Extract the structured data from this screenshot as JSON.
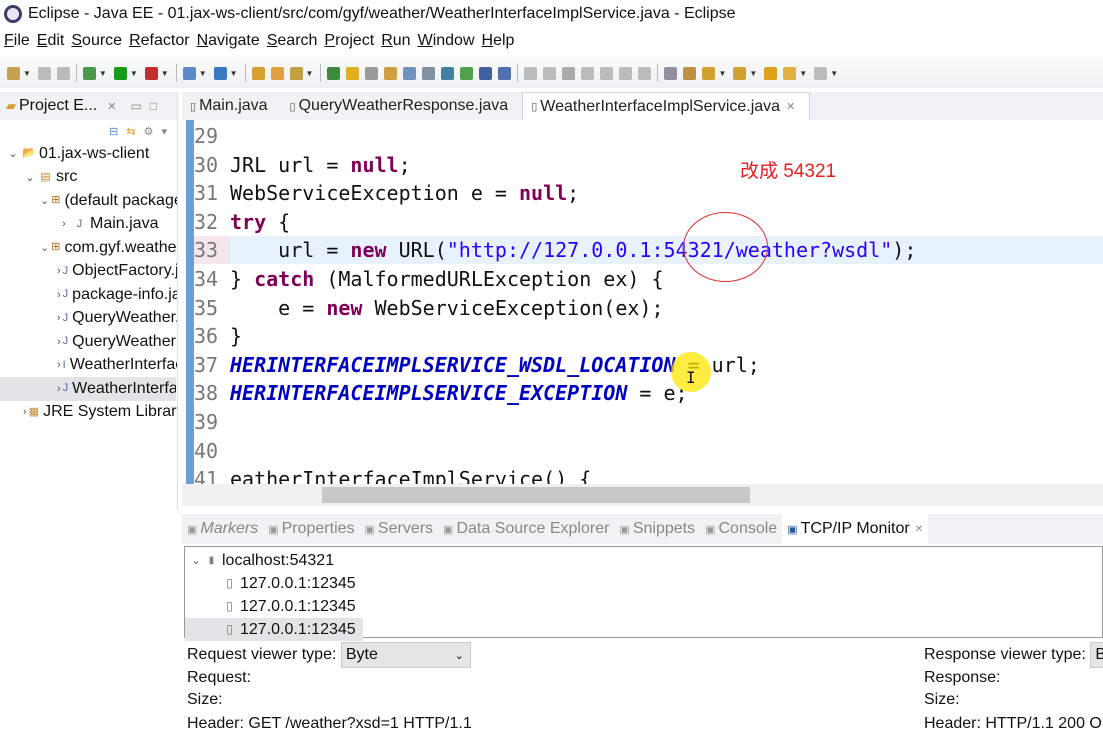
{
  "window": {
    "title": "Eclipse - Java EE - 01.jax-ws-client/src/com/gyf/weather/WeatherInterfaceImplService.java - Eclipse"
  },
  "menu": [
    "File",
    "Edit",
    "Source",
    "Refactor",
    "Navigate",
    "Search",
    "Project",
    "Run",
    "Window",
    "Help"
  ],
  "toolbar": [
    {
      "icon": "new-icon",
      "color": "#c8a050",
      "dd": true
    },
    {
      "icon": "save-icon",
      "color": "#bbb"
    },
    {
      "icon": "save-all-icon",
      "color": "#bbb",
      "sep": true
    },
    {
      "icon": "debug-icon",
      "color": "#4a9a4a",
      "dd": true
    },
    {
      "icon": "run-icon",
      "color": "#1a9a1a",
      "dd": true
    },
    {
      "icon": "external-tools-icon",
      "color": "#c03030",
      "dd": true,
      "sep": true
    },
    {
      "icon": "new-server-icon",
      "color": "#5a8ac8",
      "dd": true
    },
    {
      "icon": "web-service-icon",
      "color": "#3a7ac0",
      "dd": true,
      "sep": true
    },
    {
      "icon": "open-type-icon",
      "color": "#d8a030"
    },
    {
      "icon": "open-folder-icon",
      "color": "#e0a040"
    },
    {
      "icon": "search-icon",
      "color": "#c0a040",
      "dd": true,
      "sep": true
    },
    {
      "icon": "pin-icon",
      "color": "#3a8a3a"
    },
    {
      "icon": "highlight-icon",
      "color": "#e0b020"
    },
    {
      "icon": "link-icon",
      "color": "#999"
    },
    {
      "icon": "annotation-icon",
      "color": "#d0a040"
    },
    {
      "icon": "show-whitespace-icon",
      "color": "#7090c0"
    },
    {
      "icon": "block-icon",
      "color": "#8090a0"
    },
    {
      "icon": "globe-icon",
      "color": "#4080a0"
    },
    {
      "icon": "refresh-icon",
      "color": "#50a050"
    },
    {
      "icon": "monitor-icon",
      "color": "#4060a0"
    },
    {
      "icon": "skip-icon",
      "color": "#5070b0",
      "sep": true
    },
    {
      "icon": "resume-icon",
      "color": "#bbb"
    },
    {
      "icon": "suspend-icon",
      "color": "#bbb"
    },
    {
      "icon": "stop-icon",
      "color": "#aaa"
    },
    {
      "icon": "disconnect-icon",
      "color": "#bbb"
    },
    {
      "icon": "step-into-icon",
      "color": "#bbb"
    },
    {
      "icon": "step-over-icon",
      "color": "#bbb"
    },
    {
      "icon": "step-return-icon",
      "color": "#bbb",
      "sep": true
    },
    {
      "icon": "task-icon",
      "color": "#9090a0"
    },
    {
      "icon": "palette-icon",
      "color": "#c09040"
    },
    {
      "icon": "next-annotation-icon",
      "color": "#d0a030",
      "dd": true
    },
    {
      "icon": "prev-annotation-icon",
      "color": "#d0a030",
      "dd": true
    },
    {
      "icon": "back-icon",
      "color": "#e0a020"
    },
    {
      "icon": "back-arrow-icon",
      "color": "#e0b040",
      "dd": true
    },
    {
      "icon": "forward-icon",
      "color": "#bbb",
      "dd": true
    }
  ],
  "explorer": {
    "title": "Project E...",
    "items": [
      {
        "label": "01.jax-ws-client",
        "indent": 0,
        "arrow": "⌄",
        "icon": "project-icon",
        "glyph": "📂",
        "selected": false
      },
      {
        "label": "src",
        "indent": 1,
        "arrow": "⌄",
        "icon": "source-folder-icon",
        "glyph": "▤",
        "selected": false
      },
      {
        "label": "(default package)",
        "indent": 2,
        "arrow": "⌄",
        "icon": "package-icon",
        "glyph": "⊞",
        "selected": false
      },
      {
        "label": "Main.java",
        "indent": 3,
        "arrow": "›",
        "icon": "java-file-icon",
        "glyph": "J",
        "selected": false
      },
      {
        "label": "com.gyf.weather",
        "indent": 2,
        "arrow": "⌄",
        "icon": "package-icon",
        "glyph": "⊞",
        "selected": false
      },
      {
        "label": "ObjectFactory.java",
        "indent": 3,
        "arrow": "›",
        "icon": "java-file-icon",
        "glyph": "J",
        "selected": false
      },
      {
        "label": "package-info.java",
        "indent": 3,
        "arrow": "›",
        "icon": "java-file-icon",
        "glyph": "J",
        "selected": false
      },
      {
        "label": "QueryWeather.java",
        "indent": 3,
        "arrow": "›",
        "icon": "java-file-icon",
        "glyph": "J",
        "selected": false
      },
      {
        "label": "QueryWeatherResponse.java",
        "indent": 3,
        "arrow": "›",
        "icon": "java-file-icon",
        "glyph": "J",
        "selected": false
      },
      {
        "label": "WeatherInterface.java",
        "indent": 3,
        "arrow": "›",
        "icon": "java-interface-icon",
        "glyph": "I",
        "selected": false
      },
      {
        "label": "WeatherInterfaceImplService.java",
        "indent": 3,
        "arrow": "›",
        "icon": "java-file-icon",
        "glyph": "J",
        "selected": true
      },
      {
        "label": "JRE System Library",
        "indent": 1,
        "arrow": "›",
        "icon": "library-icon",
        "glyph": "▦",
        "selected": false
      }
    ]
  },
  "editor": {
    "tabs": [
      {
        "label": "Main.java",
        "active": false
      },
      {
        "label": "QueryWeatherResponse.java",
        "active": false
      },
      {
        "label": "WeatherInterfaceImplService.java",
        "active": true
      }
    ],
    "lines": [
      {
        "n": "29",
        "t": []
      },
      {
        "n": "30",
        "t": [
          [
            "p",
            "JRL url = "
          ],
          [
            "kw",
            "null"
          ],
          [
            "p",
            ";"
          ]
        ]
      },
      {
        "n": "31",
        "t": [
          [
            "p",
            "WebServiceException e = "
          ],
          [
            "kw",
            "null"
          ],
          [
            "p",
            ";"
          ]
        ]
      },
      {
        "n": "32",
        "t": [
          [
            "kw",
            "try"
          ],
          [
            "p",
            " {"
          ]
        ]
      },
      {
        "n": "33",
        "cur": true,
        "t": [
          [
            "p",
            "    url = "
          ],
          [
            "kw",
            "new"
          ],
          [
            "p",
            " URL("
          ],
          [
            "str",
            "\"http://127.0.0.1:54321/weather?wsdl\""
          ],
          [
            "p",
            ");"
          ]
        ]
      },
      {
        "n": "34",
        "t": [
          [
            "p",
            "} "
          ],
          [
            "kw",
            "catch"
          ],
          [
            "p",
            " (MalformedURLException ex) {"
          ]
        ]
      },
      {
        "n": "35",
        "t": [
          [
            "p",
            "    e = "
          ],
          [
            "kw",
            "new"
          ],
          [
            "p",
            " WebServiceException(ex);"
          ]
        ]
      },
      {
        "n": "36",
        "t": [
          [
            "p",
            "}"
          ]
        ]
      },
      {
        "n": "37",
        "t": [
          [
            "cst",
            "HERINTERFACEIMPLSERVICE_WSDL_LOCATION"
          ],
          [
            "p",
            " = url;"
          ]
        ]
      },
      {
        "n": "38",
        "t": [
          [
            "cst",
            "HERINTERFACEIMPLSERVICE_EXCEPTION"
          ],
          [
            "p",
            " = e;"
          ]
        ]
      },
      {
        "n": "39",
        "t": []
      },
      {
        "n": "40",
        "t": []
      },
      {
        "n": "41",
        "t": [
          [
            "p",
            "eatherInterfaceImplService() {"
          ]
        ]
      }
    ],
    "annotation": "改成 54321"
  },
  "bottom": {
    "tabs": [
      {
        "label": "Markers",
        "icon": "markers-icon"
      },
      {
        "label": "Properties",
        "icon": "properties-icon"
      },
      {
        "label": "Servers",
        "icon": "servers-icon"
      },
      {
        "label": "Data Source Explorer",
        "icon": "data-source-icon"
      },
      {
        "label": "Snippets",
        "icon": "snippets-icon"
      },
      {
        "label": "Console",
        "icon": "console-icon"
      },
      {
        "label": "TCP/IP Monitor",
        "icon": "tcpip-monitor-icon",
        "active": true
      }
    ],
    "tree": {
      "root": "localhost:54321",
      "children": [
        "127.0.0.1:12345",
        "127.0.0.1:12345",
        "127.0.0.1:12345"
      ],
      "selected_index": 2
    },
    "request": {
      "viewer_label": "Request viewer type:",
      "viewer_value": "Byte",
      "label": "Request:",
      "size": "Size:",
      "header": "Header: GET /weather?xsd=1 HTTP/1.1"
    },
    "response": {
      "viewer_label": "Response viewer type:",
      "viewer_value": "B",
      "label": "Response:",
      "size": "Size:",
      "header": "Header: HTTP/1.1 200 O"
    }
  }
}
